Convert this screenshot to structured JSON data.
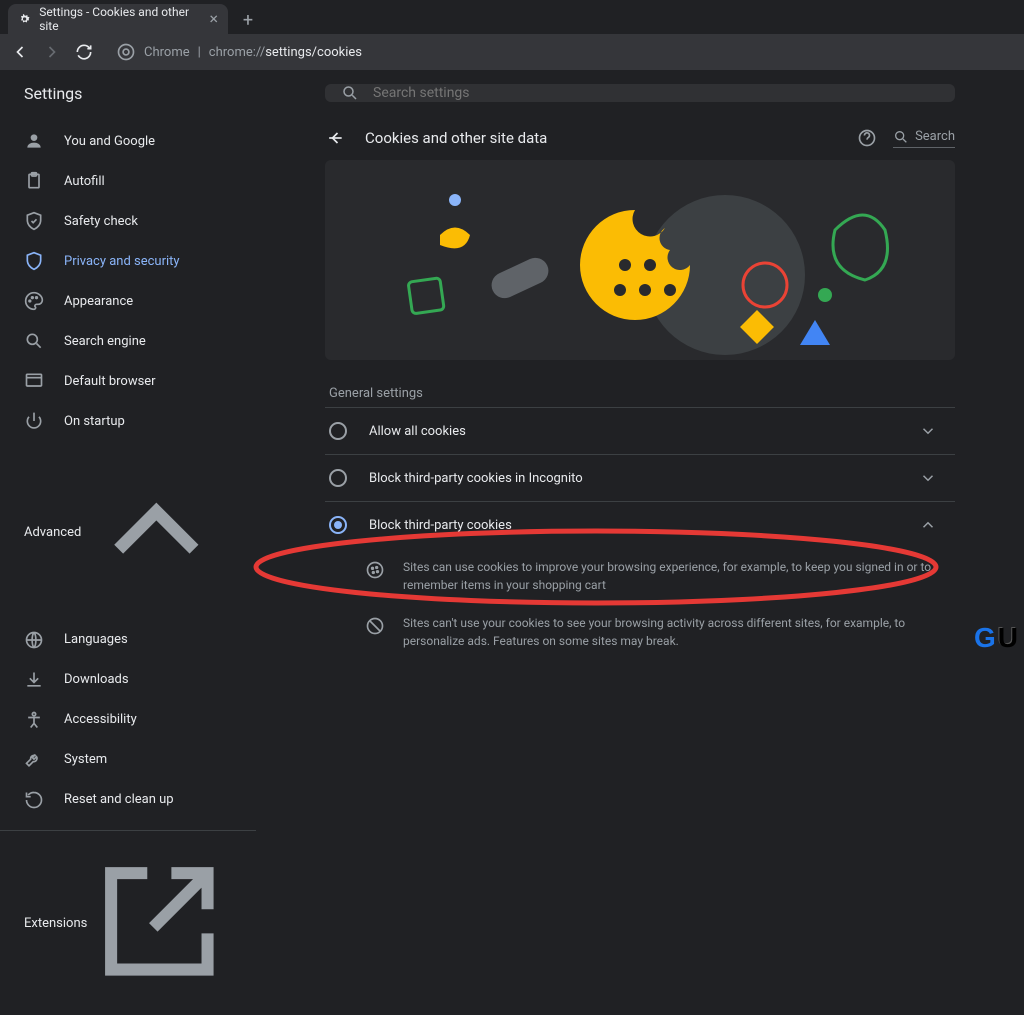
{
  "tab": {
    "title": "Settings - Cookies and other site"
  },
  "omnibox": {
    "chrome_label": "Chrome",
    "url_dim": "chrome://",
    "url_main": "settings/cookies"
  },
  "sidebar": {
    "title": "Settings",
    "advanced_label": "Advanced",
    "extensions_label": "Extensions",
    "items": [
      {
        "label": "You and Google"
      },
      {
        "label": "Autofill"
      },
      {
        "label": "Safety check"
      },
      {
        "label": "Privacy and security"
      },
      {
        "label": "Appearance"
      },
      {
        "label": "Search engine"
      },
      {
        "label": "Default browser"
      },
      {
        "label": "On startup"
      }
    ],
    "advanced_items": [
      {
        "label": "Languages"
      },
      {
        "label": "Downloads"
      },
      {
        "label": "Accessibility"
      },
      {
        "label": "System"
      },
      {
        "label": "Reset and clean up"
      }
    ]
  },
  "search": {
    "placeholder": "Search settings"
  },
  "header": {
    "title": "Cookies and other site data",
    "search_label": "Search"
  },
  "general": {
    "section_label": "General settings",
    "options": [
      {
        "label": "Allow all cookies"
      },
      {
        "label": "Block third-party cookies in Incognito"
      },
      {
        "label": "Block third-party cookies"
      }
    ],
    "details": [
      "Sites can use cookies to improve your browsing experience, for example, to keep you signed in or to remember items in your shopping cart",
      "Sites can't use your cookies to see your browsing activity across different sites, for example, to personalize ads. Features on some sites may break."
    ]
  }
}
